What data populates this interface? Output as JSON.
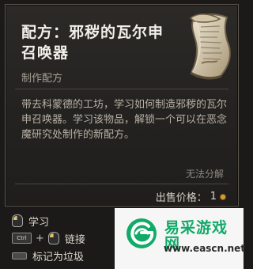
{
  "tooltip": {
    "title": "配方：邪秽的瓦尔申召唤器",
    "subtype": "制作配方",
    "description": "带去科蒙德的工坊，学习如何制造邪秽的瓦尔申召唤器。学习该物品，解锁一个可以在恶念魔研究处制作的新配方。",
    "cannot_dismantle": "无法分解",
    "price_label": "出售价格：",
    "price_value": "1",
    "icon": "scroll-icon",
    "coin_icon": "coin-icon"
  },
  "actions": {
    "learn": {
      "label": "学习",
      "key_icon": "mouse-icon"
    },
    "link": {
      "key": "Ctrl",
      "plus": "+",
      "label": "链接",
      "key_icon": "mouse-icon"
    },
    "junk": {
      "label": "标记为垃圾",
      "key_icon": "space-key-icon"
    }
  },
  "watermark": {
    "title": "易采游戏网",
    "url": "www.eascn.net"
  },
  "colors": {
    "background": "#1b1a18",
    "panel": "#252421",
    "title": "#f2efe9",
    "muted": "#a59f95",
    "watermark_green": "#11aa68"
  }
}
